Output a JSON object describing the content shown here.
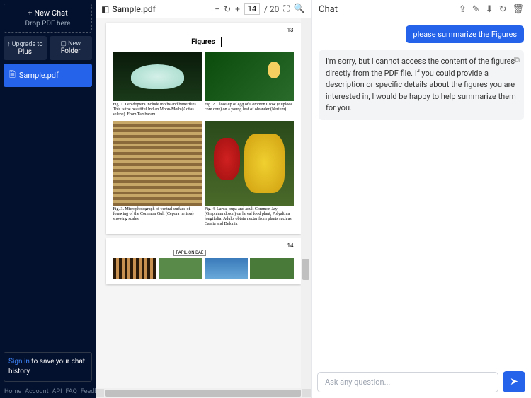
{
  "sidebar": {
    "new_chat": "New Chat",
    "drop": "Drop PDF here",
    "upgrade_top": "Upgrade to",
    "upgrade_bottom": "Plus",
    "folder_top": "New",
    "folder_bottom": "Folder",
    "file": "Sample.pdf",
    "signin": "Sign in",
    "signin_rest": " to save your chat history",
    "footer": [
      "Home",
      "Account",
      "API",
      "FAQ",
      "Feedback"
    ]
  },
  "pdf": {
    "title": "Sample.pdf",
    "page_current": "14",
    "page_total": "/ 20",
    "page1_num": "13",
    "page2_num": "14",
    "figures_heading": "Figures",
    "captions": {
      "c1": "Fig. 1. Lepidoptera include moths and butterflies. This is the beautiful Indian Moon-Moth (Actias selene). From Tambaram",
      "c2": "Fig. 2. Close-up of egg of Common Crow (Euploea core core) on a young leaf of oleander (Nerium)",
      "c3": "Fig. 3. Microphotograph of ventral surface of forewing of the Common Gull (Cepora nerissa) showing scales",
      "c4": "Fig. 4. Larva, pupa and adult Common Jay (Graphium doson) on larval food plant, Polyalthia longifolia. Adults obtain nectar from plants such as Cassia and Delonix"
    },
    "page2_label": "PAPILIONIDAE"
  },
  "chat": {
    "title": "Chat",
    "user_msg": "please summarize the Figures",
    "ai_msg": "I'm sorry, but I cannot access the content of the figures directly from the PDF file. If you could provide a description or specific details about the figures you are interested in, I would be happy to help summarize them for you.",
    "input_placeholder": "Ask any question..."
  }
}
